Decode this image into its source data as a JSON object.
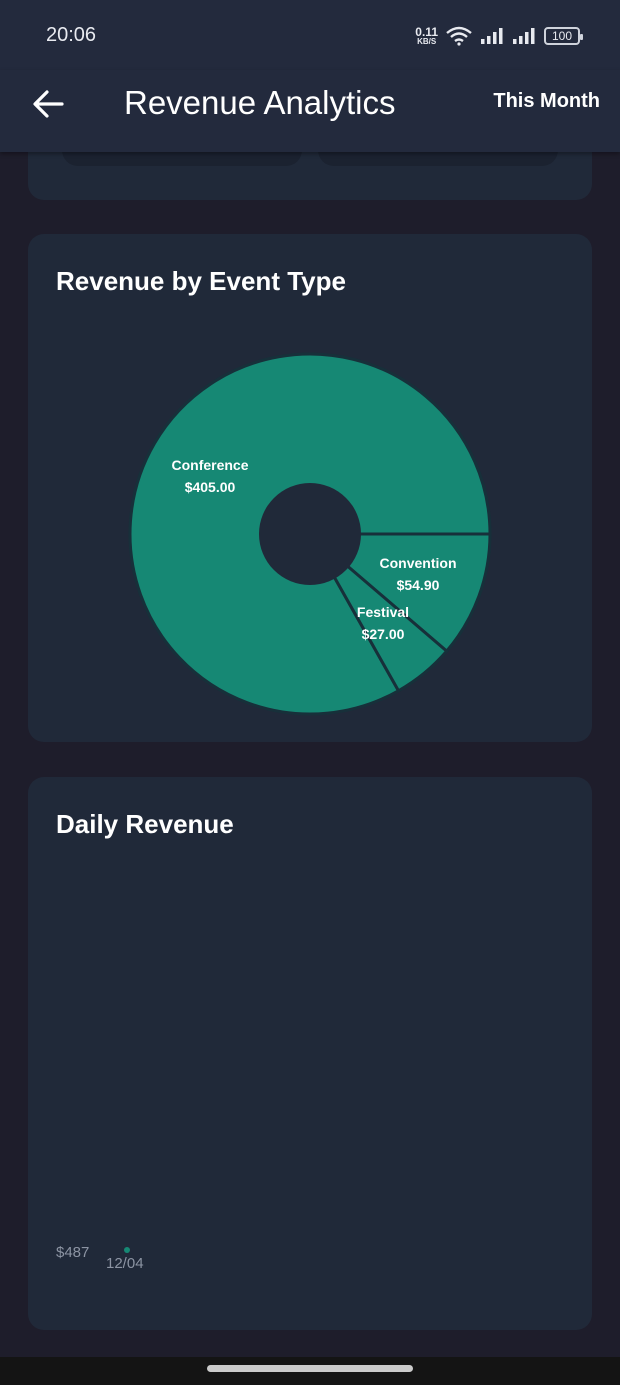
{
  "status_bar": {
    "time": "20:06",
    "net_speed_value": "0.11",
    "net_speed_unit": "KB/S",
    "battery": "100"
  },
  "app_bar": {
    "back_icon": "arrow-left-icon",
    "title": "Revenue Analytics",
    "period": "This Month"
  },
  "colors": {
    "app_bar_bg": "#232a3d",
    "card_bg": "#202939",
    "page_bg": "#1e1d2b",
    "accent_teal": "#168874"
  },
  "revenue_by_event_type": {
    "title": "Revenue by Event Type"
  },
  "daily_revenue": {
    "title": "Daily Revenue"
  },
  "chart_data": [
    {
      "type": "pie",
      "title": "Revenue by Event Type",
      "donut": true,
      "slices": [
        {
          "name": "Conference",
          "value": 405.0,
          "label": "$405.00"
        },
        {
          "name": "Convention",
          "value": 54.9,
          "label": "$54.90"
        },
        {
          "name": "Festival",
          "value": 27.0,
          "label": "$27.00"
        }
      ]
    },
    {
      "type": "line",
      "title": "Daily Revenue",
      "x": [
        "12/04"
      ],
      "y": [
        487
      ],
      "y_tick_labels": [
        "$487"
      ],
      "x_tick_labels": [
        "12/04"
      ]
    }
  ]
}
